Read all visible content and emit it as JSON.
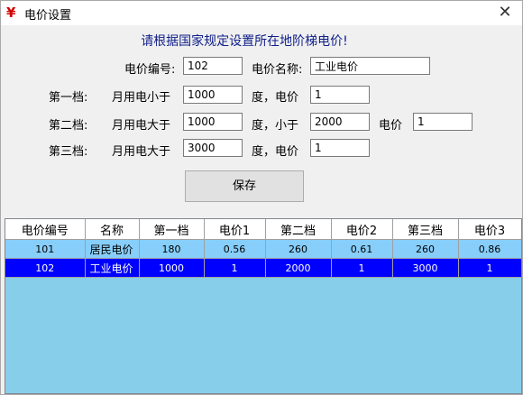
{
  "window": {
    "title": "电价设置",
    "icon": "yen-icon",
    "close_label": "✕"
  },
  "form": {
    "heading": "请根据国家规定设置所在地阶梯电价!",
    "code_label": "电价编号:",
    "code_value": "102",
    "name_label": "电价名称:",
    "name_value": "工业电价",
    "tier1": {
      "label": "第一档:",
      "cond": "月用电小于",
      "amount": "1000",
      "unit": "度，电价",
      "price": "1"
    },
    "tier2": {
      "label": "第二档:",
      "cond": "月用电大于",
      "amount": "1000",
      "unit": "度，小于",
      "upper": "2000",
      "price_label": "电价",
      "price": "1"
    },
    "tier3": {
      "label": "第三档:",
      "cond": "月用电大于",
      "amount": "3000",
      "unit": "度，电价",
      "price": "1"
    },
    "save_label": "保存"
  },
  "table": {
    "headers": [
      "电价编号",
      "名称",
      "第一档",
      "电价1",
      "第二档",
      "电价2",
      "第三档",
      "电价3"
    ],
    "rows": [
      [
        "101",
        "居民电价",
        "180",
        "0.56",
        "260",
        "0.61",
        "260",
        "0.86"
      ],
      [
        "102",
        "工业电价",
        "1000",
        "1",
        "2000",
        "1",
        "3000",
        "1"
      ]
    ],
    "selected_row": 1
  },
  "colors": {
    "heading": "#10208a",
    "grid_bg": "#87ceeb",
    "selection": "#0000ff",
    "icon": "#d40000"
  }
}
